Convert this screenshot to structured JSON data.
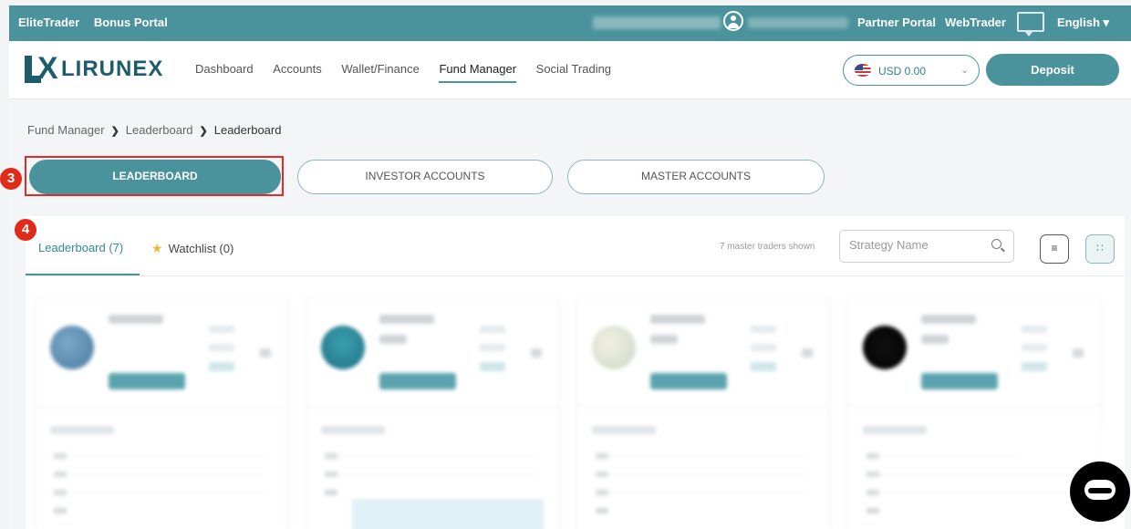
{
  "topbar": {
    "brand_items": [
      "EliteTrader",
      "Bonus Portal"
    ],
    "partner_portal": "Partner Portal",
    "webtrader": "WebTrader",
    "language": "English ▾",
    "icons": [
      "user-icon",
      "chat-icon"
    ]
  },
  "nav": {
    "logo_text": "LIRUNEX",
    "menu": [
      "Dashboard",
      "Accounts",
      "Wallet/Finance",
      "Fund Manager",
      "Social Trading"
    ],
    "active_menu": "Fund Manager",
    "currency": "USD 0.00",
    "deposit": "Deposit"
  },
  "breadcrumb": [
    "Fund Manager",
    "Leaderboard",
    "Leaderboard"
  ],
  "tabs": [
    "LEADERBOARD",
    "INVESTOR ACCOUNTS",
    "MASTER ACCOUNTS"
  ],
  "annotations": [
    "3",
    "4"
  ],
  "panel": {
    "tab_leaderboard": "Leaderboard (7)",
    "tab_watchlist": "Watchlist (0)",
    "shown_text": "7 master traders shown",
    "search_placeholder": "Strategy Name"
  },
  "colors": {
    "accent": "#4a939d",
    "brand_dark": "#1d5d69",
    "highlight": "#e12a2a"
  }
}
